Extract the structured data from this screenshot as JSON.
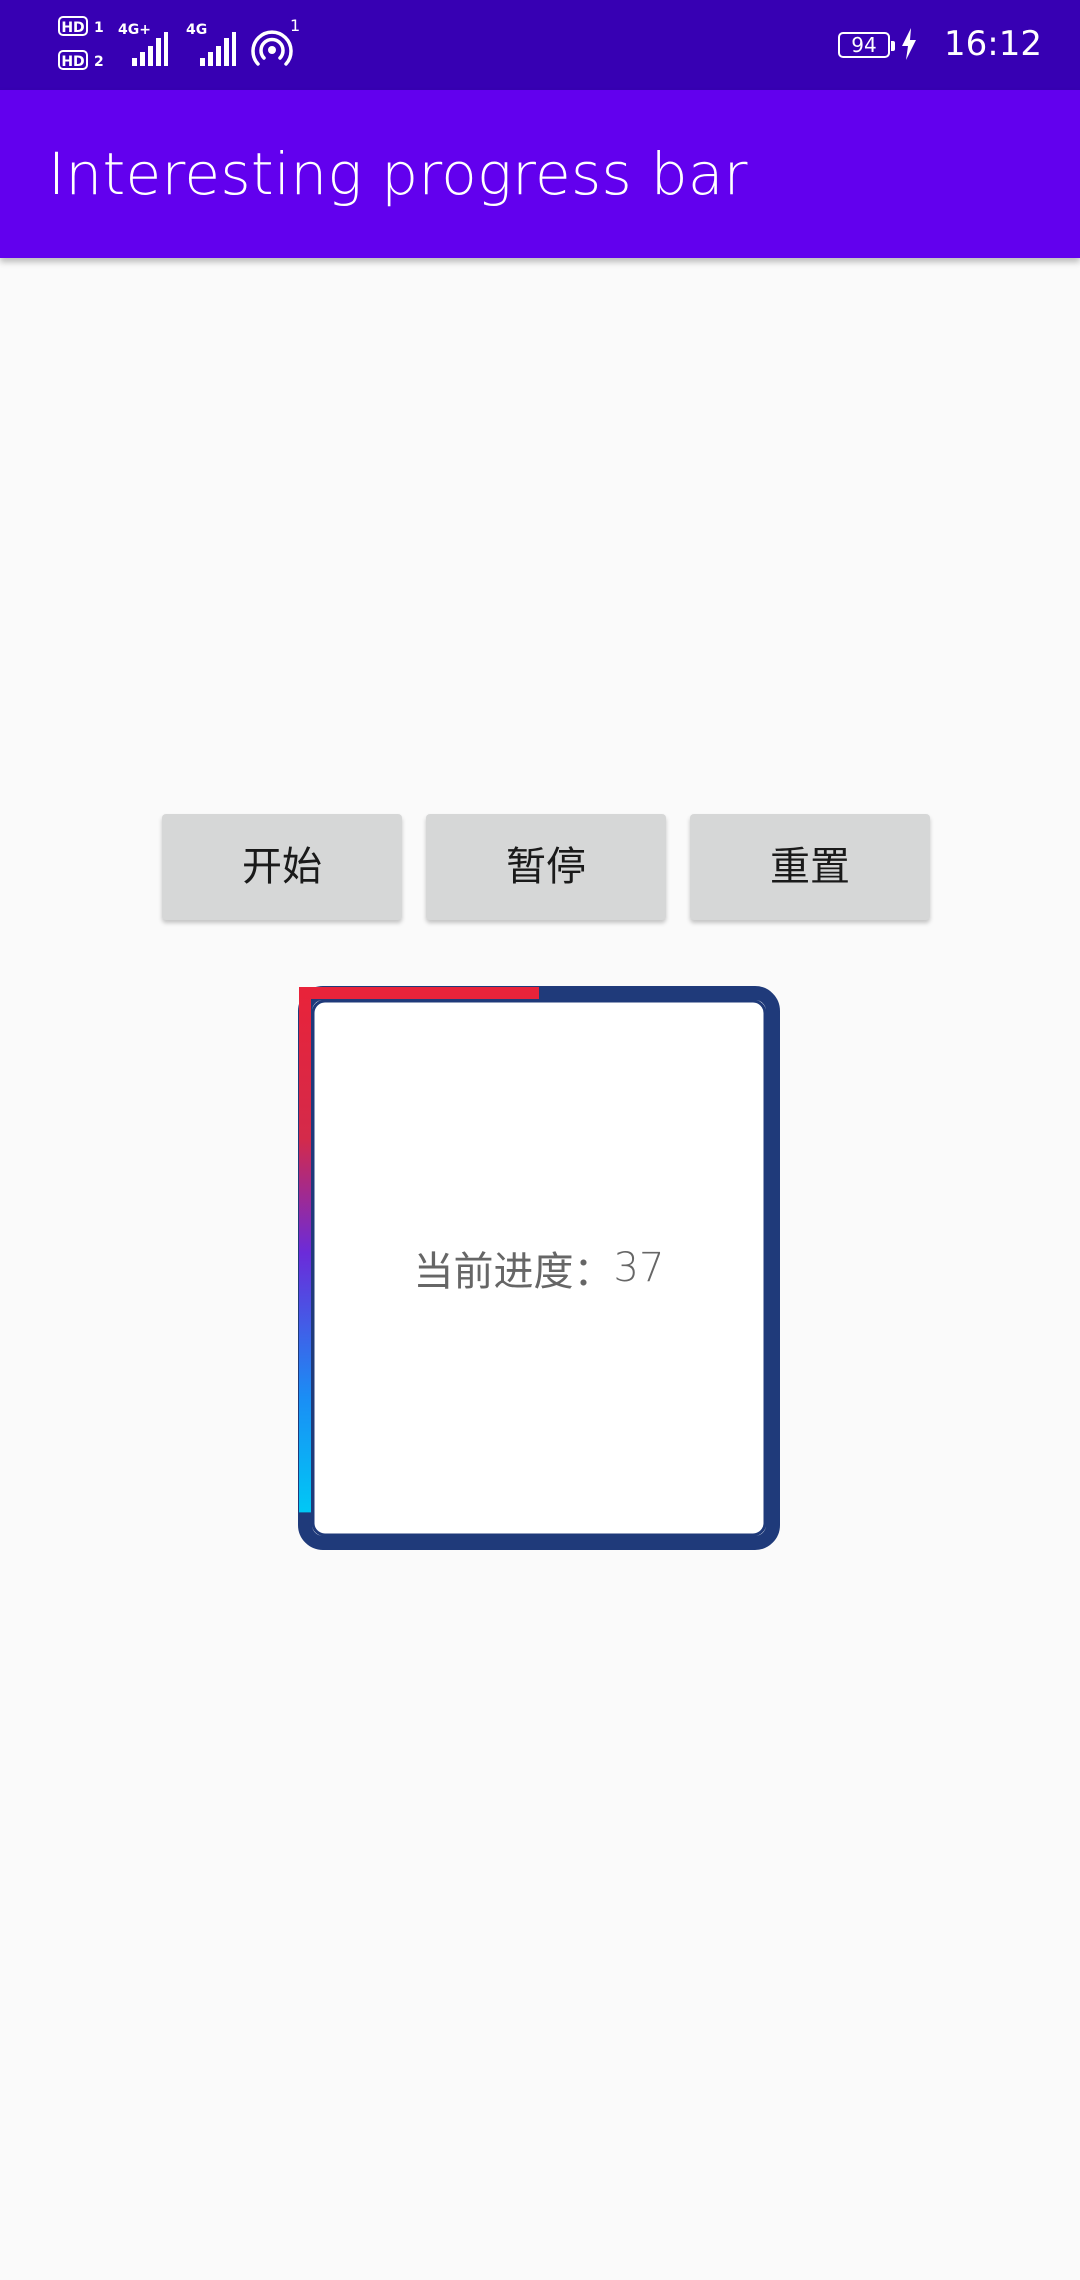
{
  "status_bar": {
    "hd1": "HD",
    "hd1_sub": "1",
    "hd2": "HD",
    "hd2_sub": "2",
    "net1": "4G+",
    "net2": "4G",
    "hotspot_count": "1",
    "battery": "94",
    "time": "16:12"
  },
  "app_bar": {
    "title": "Interesting progress bar"
  },
  "buttons": {
    "start": "开始",
    "pause": "暂停",
    "reset": "重置"
  },
  "progress": {
    "label": "当前进度：",
    "value": "37",
    "value_num": 37,
    "track_color": "#1f3a7a",
    "gradient_start": "#e8233a",
    "gradient_mid": "#6b2bd9",
    "gradient_end": "#00c8f5"
  }
}
